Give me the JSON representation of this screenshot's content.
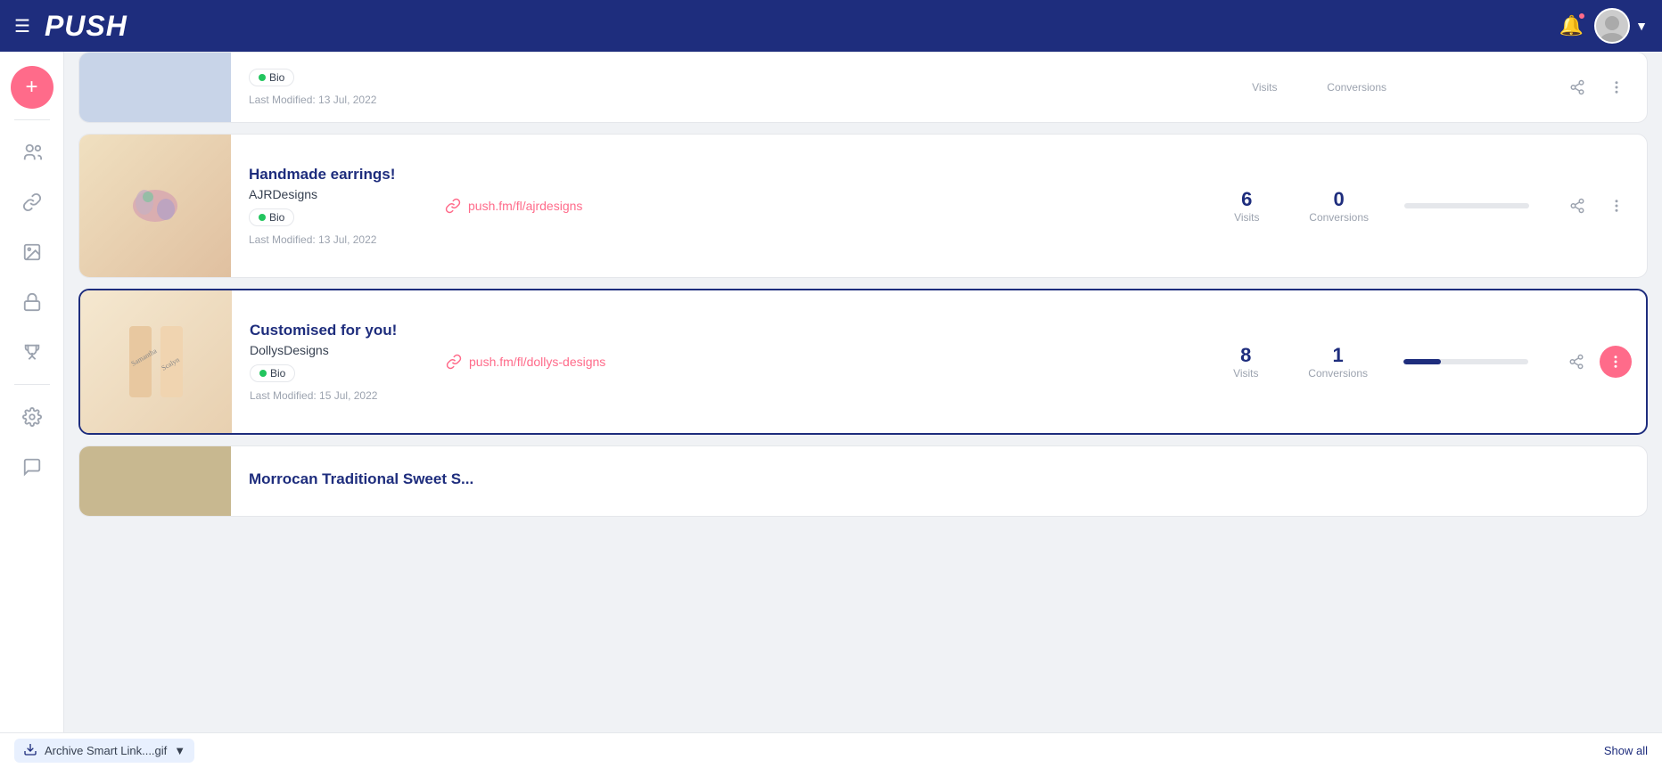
{
  "app": {
    "logo": "PUSH",
    "nav_right": {
      "bell_label": "notifications",
      "avatar_label": "user avatar"
    }
  },
  "sidebar": {
    "items": [
      {
        "id": "add",
        "icon": "+",
        "label": "add",
        "active": false,
        "special": true
      },
      {
        "id": "audience",
        "icon": "audience",
        "label": "audience"
      },
      {
        "id": "links",
        "icon": "links",
        "label": "links"
      },
      {
        "id": "media",
        "icon": "media",
        "label": "media"
      },
      {
        "id": "lock",
        "icon": "lock",
        "label": "lock"
      },
      {
        "id": "trophy",
        "icon": "trophy",
        "label": "trophy"
      },
      {
        "id": "settings",
        "icon": "settings",
        "label": "settings"
      },
      {
        "id": "chat",
        "icon": "chat",
        "label": "chat"
      }
    ]
  },
  "cards": [
    {
      "id": "partial-top",
      "partial": true,
      "position": "top",
      "title": "",
      "subtitle": "",
      "badge": "Bio",
      "modified": "Last Modified: 13 Jul, 2022",
      "url": "",
      "visits": null,
      "visits_label": "Visits",
      "conversions": null,
      "conversions_label": "Conversions",
      "progress": 0,
      "image_color": "#c8d4e8"
    },
    {
      "id": "ajr-designs",
      "partial": false,
      "title": "Handmade earrings!",
      "subtitle": "AJRDesigns",
      "badge": "Bio",
      "modified": "Last Modified: 13 Jul, 2022",
      "url": "push.fm/fl/ajrdesigns",
      "visits": 6,
      "visits_label": "Visits",
      "conversions": 0,
      "conversions_label": "Conversions",
      "progress": 0,
      "image_color": "#e8d5c0"
    },
    {
      "id": "dollys-designs",
      "partial": false,
      "highlighted": true,
      "title": "Customised for you!",
      "subtitle": "DollysDesigns",
      "badge": "Bio",
      "modified": "Last Modified: 15 Jul, 2022",
      "url": "push.fm/fl/dollys-designs",
      "visits": 8,
      "visits_label": "Visits",
      "conversions": 1,
      "conversions_label": "Conversions",
      "progress": 8,
      "image_color": "#e8c8a0"
    },
    {
      "id": "morrocan-partial",
      "partial": true,
      "position": "bottom",
      "title": "Morrocan Traditional Sweet S...",
      "subtitle": "",
      "badge": "",
      "modified": "",
      "url": "",
      "visits": null,
      "visits_label": "",
      "conversions": null,
      "conversions_label": "",
      "progress": 0,
      "image_color": "#c8b890"
    }
  ],
  "bottom_bar": {
    "download_label": "Archive Smart Link....gif",
    "show_all_label": "Show all"
  }
}
